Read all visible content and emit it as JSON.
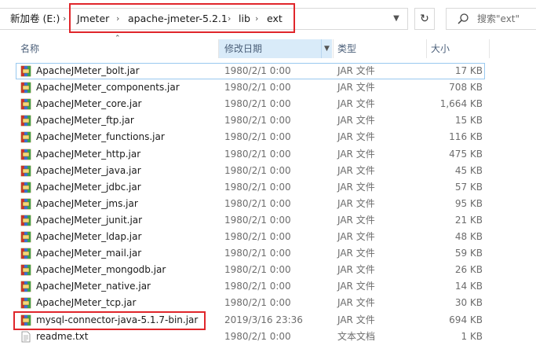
{
  "address": {
    "drive": "新加卷 (E:)",
    "path": [
      "Jmeter",
      "apache-jmeter-5.2.1",
      "lib",
      "ext"
    ]
  },
  "search": {
    "placeholder": "搜索\"ext\""
  },
  "columns": {
    "name": "名称",
    "date": "修改日期",
    "type": "类型",
    "size": "大小"
  },
  "colors": {
    "highlight": "#e0262b",
    "header_active": "#d9ebf9",
    "selected_border": "#99c9ef"
  },
  "files": [
    {
      "name": "ApacheJMeter_bolt.jar",
      "date": "1980/2/1 0:00",
      "type": "JAR 文件",
      "size": "17 KB",
      "icon": "jar-icon"
    },
    {
      "name": "ApacheJMeter_components.jar",
      "date": "1980/2/1 0:00",
      "type": "JAR 文件",
      "size": "708 KB",
      "icon": "jar-icon"
    },
    {
      "name": "ApacheJMeter_core.jar",
      "date": "1980/2/1 0:00",
      "type": "JAR 文件",
      "size": "1,664 KB",
      "icon": "jar-icon"
    },
    {
      "name": "ApacheJMeter_ftp.jar",
      "date": "1980/2/1 0:00",
      "type": "JAR 文件",
      "size": "15 KB",
      "icon": "jar-icon"
    },
    {
      "name": "ApacheJMeter_functions.jar",
      "date": "1980/2/1 0:00",
      "type": "JAR 文件",
      "size": "116 KB",
      "icon": "jar-icon"
    },
    {
      "name": "ApacheJMeter_http.jar",
      "date": "1980/2/1 0:00",
      "type": "JAR 文件",
      "size": "475 KB",
      "icon": "jar-icon"
    },
    {
      "name": "ApacheJMeter_java.jar",
      "date": "1980/2/1 0:00",
      "type": "JAR 文件",
      "size": "45 KB",
      "icon": "jar-icon"
    },
    {
      "name": "ApacheJMeter_jdbc.jar",
      "date": "1980/2/1 0:00",
      "type": "JAR 文件",
      "size": "57 KB",
      "icon": "jar-icon"
    },
    {
      "name": "ApacheJMeter_jms.jar",
      "date": "1980/2/1 0:00",
      "type": "JAR 文件",
      "size": "95 KB",
      "icon": "jar-icon"
    },
    {
      "name": "ApacheJMeter_junit.jar",
      "date": "1980/2/1 0:00",
      "type": "JAR 文件",
      "size": "21 KB",
      "icon": "jar-icon"
    },
    {
      "name": "ApacheJMeter_ldap.jar",
      "date": "1980/2/1 0:00",
      "type": "JAR 文件",
      "size": "48 KB",
      "icon": "jar-icon"
    },
    {
      "name": "ApacheJMeter_mail.jar",
      "date": "1980/2/1 0:00",
      "type": "JAR 文件",
      "size": "59 KB",
      "icon": "jar-icon"
    },
    {
      "name": "ApacheJMeter_mongodb.jar",
      "date": "1980/2/1 0:00",
      "type": "JAR 文件",
      "size": "26 KB",
      "icon": "jar-icon"
    },
    {
      "name": "ApacheJMeter_native.jar",
      "date": "1980/2/1 0:00",
      "type": "JAR 文件",
      "size": "14 KB",
      "icon": "jar-icon"
    },
    {
      "name": "ApacheJMeter_tcp.jar",
      "date": "1980/2/1 0:00",
      "type": "JAR 文件",
      "size": "30 KB",
      "icon": "jar-icon"
    },
    {
      "name": "mysql-connector-java-5.1.7-bin.jar",
      "date": "2019/3/16 23:36",
      "type": "JAR 文件",
      "size": "694 KB",
      "icon": "jar-icon"
    },
    {
      "name": "readme.txt",
      "date": "1980/2/1 0:00",
      "type": "文本文档",
      "size": "1 KB",
      "icon": "text-file-icon"
    }
  ]
}
